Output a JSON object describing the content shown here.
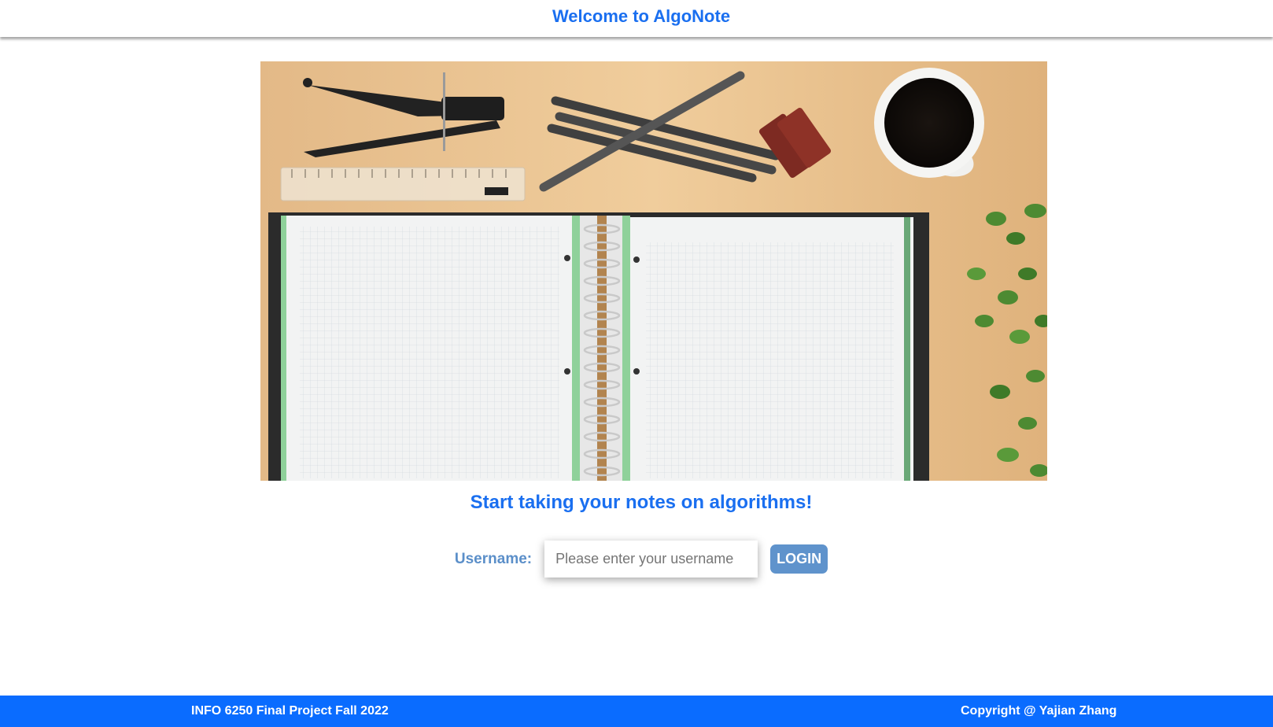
{
  "header": {
    "title": "Welcome to AlgoNote"
  },
  "hero": {
    "image_name": "notebook-desk-image"
  },
  "main": {
    "tagline": "Start taking your notes on algorithms!",
    "login": {
      "label": "Username:",
      "input_placeholder": "Please enter your username",
      "input_value": "",
      "button_label": "LOGIN"
    }
  },
  "footer": {
    "left_text": "INFO 6250 Final Project Fall 2022",
    "right_text": "Copyright @ Yajian Zhang"
  },
  "colors": {
    "accent": "#1a6ff0",
    "label": "#5b8fc9",
    "button": "#5f93cc",
    "footer": "#0a6cff"
  }
}
